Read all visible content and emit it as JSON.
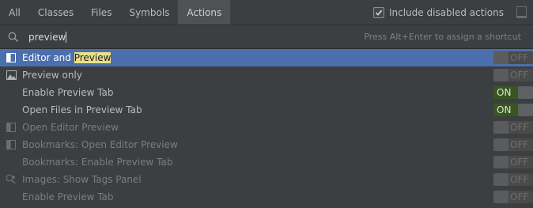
{
  "tabs": [
    {
      "label": "All"
    },
    {
      "label": "Classes"
    },
    {
      "label": "Files"
    },
    {
      "label": "Symbols"
    },
    {
      "label": "Actions",
      "active": true
    }
  ],
  "include_disabled": {
    "label": "Include disabled actions",
    "checked": true
  },
  "search": {
    "value": "preview",
    "hint": "Press Alt+Enter to assign a shortcut"
  },
  "results": [
    {
      "label_pre": "Editor and ",
      "label_hl": "Preview",
      "icon": "split-editor-icon",
      "toggle": "OFF",
      "selected": true,
      "disabled": false
    },
    {
      "label_pre": "Preview only",
      "label_hl": "",
      "icon": "image-icon",
      "toggle": "OFF",
      "selected": false,
      "disabled": false
    },
    {
      "label_pre": "Enable Preview Tab",
      "label_hl": "",
      "icon": "",
      "toggle": "ON",
      "selected": false,
      "disabled": false
    },
    {
      "label_pre": "Open Files in Preview Tab",
      "label_hl": "",
      "icon": "",
      "toggle": "ON",
      "selected": false,
      "disabled": false
    },
    {
      "label_pre": "Open Editor Preview",
      "label_hl": "",
      "icon": "split-editor-icon",
      "toggle": "OFF",
      "selected": false,
      "disabled": true
    },
    {
      "label_pre": "Bookmarks: Open Editor Preview",
      "label_hl": "",
      "icon": "split-editor-icon",
      "toggle": "OFF",
      "selected": false,
      "disabled": true
    },
    {
      "label_pre": "Bookmarks: Enable Preview Tab",
      "label_hl": "",
      "icon": "",
      "toggle": "OFF",
      "selected": false,
      "disabled": true
    },
    {
      "label_pre": "Images: Show Tags Panel",
      "label_hl": "",
      "icon": "tags-icon",
      "toggle": "OFF",
      "selected": false,
      "disabled": true
    },
    {
      "label_pre": "Enable Preview Tab",
      "label_hl": "",
      "icon": "",
      "toggle": "OFF",
      "selected": false,
      "disabled": true
    }
  ]
}
